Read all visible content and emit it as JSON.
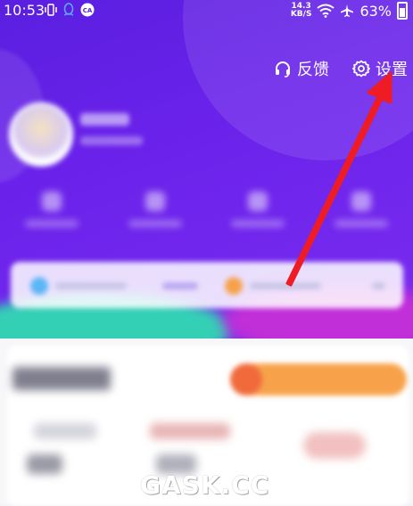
{
  "status_bar": {
    "time": "10:53",
    "net_speed_value": "14.3",
    "net_speed_unit": "KB/S",
    "battery": "63%"
  },
  "header": {
    "feedback_label": "反馈",
    "settings_label": "设置"
  },
  "icons": {
    "feedback": "headset-icon",
    "settings": "gear-icon"
  },
  "colors": {
    "header_purple": "#6a22ea",
    "annotation_arrow": "#ee1c25"
  },
  "watermark": "GASK.CC"
}
